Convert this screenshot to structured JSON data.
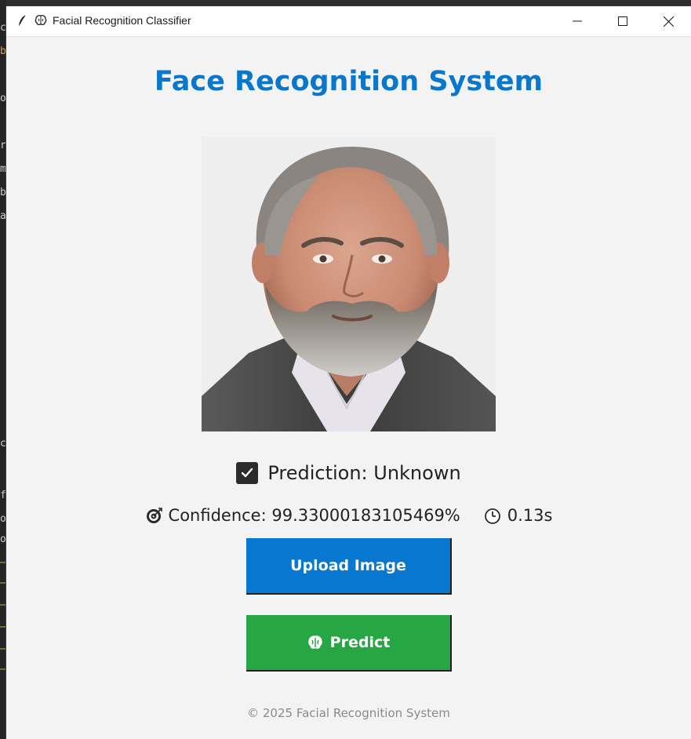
{
  "window": {
    "title": "Facial Recognition Classifier",
    "minimize_icon": "minimize-icon",
    "maximize_icon": "maximize-icon",
    "close_icon": "close-icon"
  },
  "app": {
    "heading": "Face Recognition System",
    "heading_color": "#0877cc"
  },
  "image": {
    "subject": "face-photo"
  },
  "prediction": {
    "label": "Prediction: Unknown",
    "icon": "check-icon"
  },
  "stats": {
    "confidence": "Confidence: 99.33000183105469%",
    "confidence_icon": "target-icon",
    "time": "0.13s",
    "time_icon": "clock-icon"
  },
  "buttons": {
    "upload_label": "Upload Image",
    "upload_color": "#0877d0",
    "predict_label": "Predict",
    "predict_color": "#27a644",
    "predict_icon": "brain-icon"
  },
  "footer": {
    "text": "© 2025 Facial Recognition System"
  },
  "background_editor": {
    "fragments": [
      "c",
      "b",
      "o",
      "r",
      "m",
      "b",
      "a",
      "c",
      "f",
      "o",
      "o"
    ]
  }
}
